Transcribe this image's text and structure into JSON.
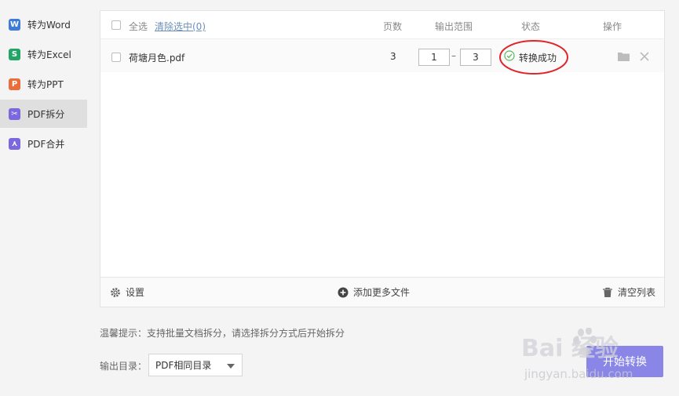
{
  "sidebar": {
    "items": [
      {
        "label": "转为Word",
        "icon_char": "W",
        "color": "#3f7bd6"
      },
      {
        "label": "转为Excel",
        "icon_char": "S",
        "color": "#23a567"
      },
      {
        "label": "转为PPT",
        "icon_char": "P",
        "color": "#ea6d3a"
      },
      {
        "label": "PDF拆分",
        "icon_char": "✂",
        "color": "#7b68de",
        "active": true
      },
      {
        "label": "PDF合并",
        "icon_char": "⋏",
        "color": "#7b68de"
      }
    ]
  },
  "table": {
    "headers": {
      "select_all": "全选",
      "clear_selected": "清除选中(0)",
      "pages": "页数",
      "output_range": "输出范围",
      "status": "状态",
      "actions": "操作"
    },
    "rows": [
      {
        "file_name": "荷塘月色.pdf",
        "pages": "3",
        "range_from": "1",
        "range_sep": "–",
        "range_to": "3",
        "status": "转换成功",
        "status_color": "#5cb85c"
      }
    ]
  },
  "footer": {
    "settings": "设置",
    "add_more": "添加更多文件",
    "clear_list": "清空列表"
  },
  "hint": "温馨提示：支持批量文档拆分，请选择拆分方式后开始拆分",
  "output_dir": {
    "label": "输出目录：",
    "selected": "PDF相同目录"
  },
  "start_button": "开始转换",
  "watermark": {
    "brand": "Bai  经验",
    "url": "jingyan.baidu.com"
  },
  "colors": {
    "accent": "#8a86e8",
    "annotation_circle": "#e0242a"
  }
}
